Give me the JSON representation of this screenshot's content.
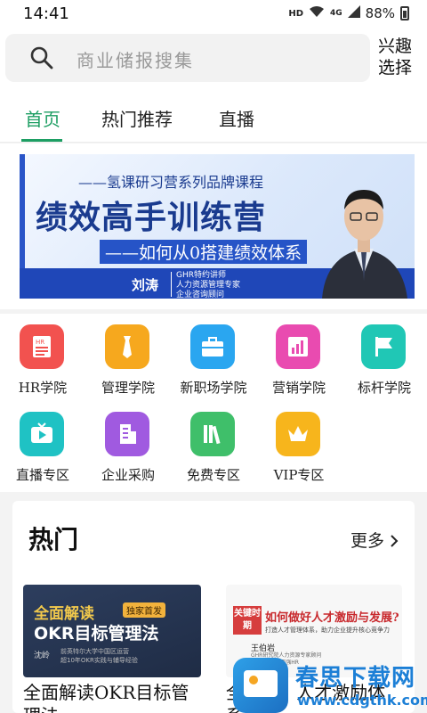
{
  "status": {
    "time": "14:41",
    "hd": "HD",
    "signal": "4G",
    "battery": "88%"
  },
  "search": {
    "placeholder": "商业储报搜集",
    "interest": "兴趣选择"
  },
  "tabs": [
    {
      "label": "首页",
      "active": true
    },
    {
      "label": "热门推荐",
      "active": false
    },
    {
      "label": "直播",
      "active": false
    }
  ],
  "banner": {
    "subtitle": "——氢课研习营系列品牌课程",
    "title": "绩效高手训练营",
    "tagline": "——如何从0搭建绩效体系",
    "speaker": "刘涛",
    "info": [
      "GHR特约讲师",
      "人力资源管理专家",
      "企业咨询顾问"
    ]
  },
  "categories": [
    {
      "label": "HR学院",
      "icon": "hr-doc-icon",
      "color": "#f2524f"
    },
    {
      "label": "管理学院",
      "icon": "tie-icon",
      "color": "#f6a81e"
    },
    {
      "label": "新职场学院",
      "icon": "briefcase-icon",
      "color": "#2aa6f0"
    },
    {
      "label": "营销学院",
      "icon": "chart-icon",
      "color": "#e94bb0"
    },
    {
      "label": "标杆学院",
      "icon": "flag-icon",
      "color": "#20c7b5"
    },
    {
      "label": "直播专区",
      "icon": "tv-icon",
      "color": "#1fc2c4"
    },
    {
      "label": "企业采购",
      "icon": "building-icon",
      "color": "#a05ae0"
    },
    {
      "label": "免费专区",
      "icon": "books-icon",
      "color": "#3fbf6a"
    },
    {
      "label": "VIP专区",
      "icon": "crown-icon",
      "color": "#f7b51c"
    }
  ],
  "hot": {
    "title": "热门",
    "more": "更多",
    "cards": [
      {
        "caption": "全面解读OKR目标管理法",
        "img_t1": "全面解读",
        "img_badge": "独家首发",
        "img_t2": "OKR目标管理法",
        "img_author": "沈岭",
        "img_desc": [
          "前英特尔大学中国区运营",
          "超10年OKR实践与辅导经验"
        ]
      },
      {
        "caption": "全...发：人才激励体系...",
        "img_box": "关键时期",
        "img_t1": "如何做好人才激励与发展?",
        "img_t2": "打造人才管理体系，助力企业提升核心竞争力",
        "img_author": "王伯岩",
        "img_desc": [
          "GHR研究院人力资源专家顾问",
          "2016年中国百强HR"
        ]
      }
    ]
  },
  "watermark": {
    "brand": "春思下载网",
    "url": "www.cdgthk.com"
  }
}
